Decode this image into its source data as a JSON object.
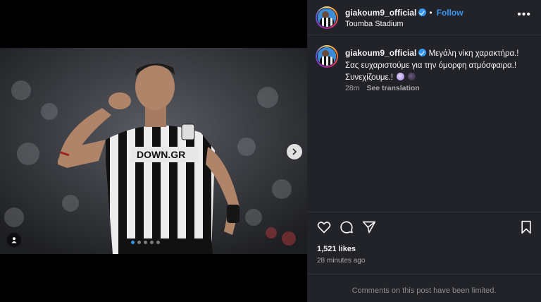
{
  "post": {
    "author": "giakoum9_official",
    "follow_label": "Follow",
    "separator": "•",
    "location": "Toumba Stadium",
    "more_label": "•••",
    "caption_line1": "Μεγάλη νίκη χαρακτήρα.!",
    "caption_line2": "Σας ευχαριστούμε για την όμορφη ατμόσφαιρα.!",
    "caption_line3": "Συνεχίζουμε.!",
    "caption_time": "28m",
    "see_translation": "See translation",
    "likes": "1,521 likes",
    "posted_ago": "28 minutes ago",
    "comments_limited": "Comments on this post have been limited.",
    "jersey_sponsor": "DOWN.GR"
  },
  "carousel": {
    "total_slides": 5,
    "active_slide": 1
  },
  "icons": {
    "like": "heart-icon",
    "comment": "comment-icon",
    "share": "share-icon",
    "save": "bookmark-icon",
    "next": "chevron-right-icon",
    "tags": "user-tag-icon"
  },
  "colors": {
    "accent": "#3897f0",
    "panel_bg": "#212328",
    "muted_text": "#a8a8a8"
  }
}
